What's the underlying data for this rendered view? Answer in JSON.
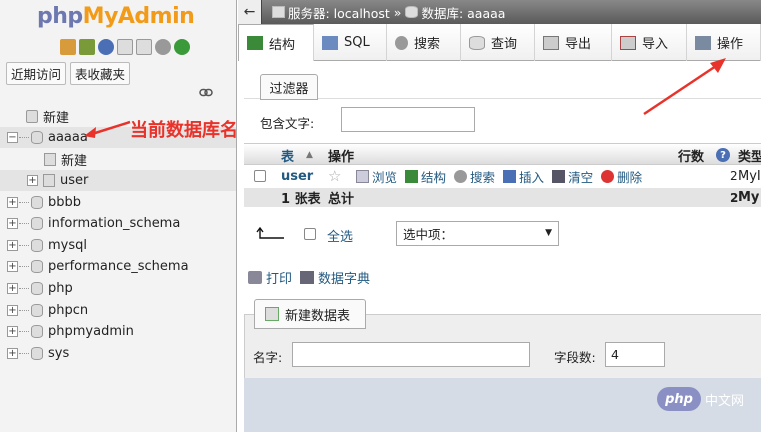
{
  "nav": {
    "logo_php": "php",
    "logo_my": "MyAdmin",
    "links": [
      "近期访问",
      "表收藏夹"
    ],
    "tree": [
      {
        "label": "新建",
        "kind": "new"
      },
      {
        "label": "aaaaa",
        "kind": "db",
        "selected": true
      },
      {
        "label": "新建",
        "kind": "new-table"
      },
      {
        "label": "user",
        "kind": "table"
      },
      {
        "label": "bbbb",
        "kind": "db"
      },
      {
        "label": "information_schema",
        "kind": "db"
      },
      {
        "label": "mysql",
        "kind": "db"
      },
      {
        "label": "performance_schema",
        "kind": "db"
      },
      {
        "label": "php",
        "kind": "db"
      },
      {
        "label": "phpcn",
        "kind": "db"
      },
      {
        "label": "phpmyadmin",
        "kind": "db"
      },
      {
        "label": "sys",
        "kind": "db"
      }
    ]
  },
  "annotation": {
    "text": "当前数据库名",
    "color": "#e8322a"
  },
  "breadcrumb": {
    "server": "服务器: localhost",
    "sep": "»",
    "database": "数据库: aaaaa"
  },
  "tabs": [
    "结构",
    "SQL",
    "搜索",
    "查询",
    "导出",
    "导入",
    "操作"
  ],
  "filter": {
    "legend": "过滤器",
    "label": "包含文字:",
    "value": ""
  },
  "table": {
    "headers": {
      "table": "表",
      "sort": "▲",
      "action": "操作",
      "rows": "行数",
      "help": "?",
      "type": "类型"
    },
    "row": {
      "name": "user",
      "actions": [
        "浏览",
        "结构",
        "搜索",
        "插入",
        "清空",
        "删除"
      ],
      "rows": "2",
      "type": "MyI"
    },
    "footer": {
      "count": "1 张表",
      "total": "总计",
      "rows": "2",
      "type": "My"
    }
  },
  "bulk": {
    "select_all": "全选",
    "select_value": "选中项："
  },
  "print": {
    "print": "打印",
    "dictionary": "数据字典"
  },
  "create": {
    "legend": "新建数据表",
    "name_label": "名字:",
    "name_value": "",
    "cols_label": "字段数:",
    "cols_value": "4"
  },
  "watermark": {
    "badge": "php",
    "text": "中文网"
  },
  "colors": {
    "accent": "#235a81",
    "logo_blue": "#6c78af",
    "logo_orange": "#f29b19",
    "annotation_red": "#e8322a"
  }
}
